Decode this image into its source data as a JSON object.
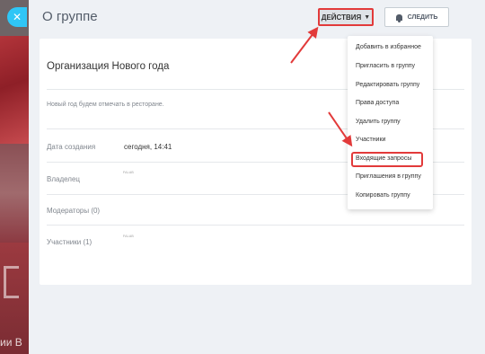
{
  "backdrop": {
    "partial_text": "ии В"
  },
  "slider": {
    "close_glyph": "✕",
    "title": "О группе"
  },
  "toolbar": {
    "actions_label": "ДЕЙСТВИЯ",
    "follow_label": "СЛЕДИТЬ"
  },
  "group": {
    "name": "Организация Нового года",
    "description": "Новый год будем отмечать в ресторане.",
    "fields": [
      {
        "label": "Дата создания",
        "value": "сегодня, 14:41"
      },
      {
        "label": "Владелец",
        "value": "",
        "avatar_tag": "FALAB"
      },
      {
        "label": "Модераторы (0)",
        "value": ""
      },
      {
        "label": "Участники (1)",
        "value": "",
        "avatar_tag": "FALAB"
      }
    ]
  },
  "actions_menu": {
    "items": [
      "Добавить в избранное",
      "Пригласить в группу",
      "Редактировать группу",
      "Права доступа",
      "Удалить группу",
      "Участники",
      "Входящие запросы",
      "Приглашения в группу",
      "Копировать группу"
    ],
    "highlighted_item": "Входящие запросы"
  },
  "colors": {
    "accent": "#2fc6f6",
    "annotation": "#e23a3a",
    "background": "#eef1f5"
  },
  "icons": {
    "close": "close-icon",
    "actions_dropdown": "chevron-down-icon",
    "follow": "bell-icon"
  }
}
